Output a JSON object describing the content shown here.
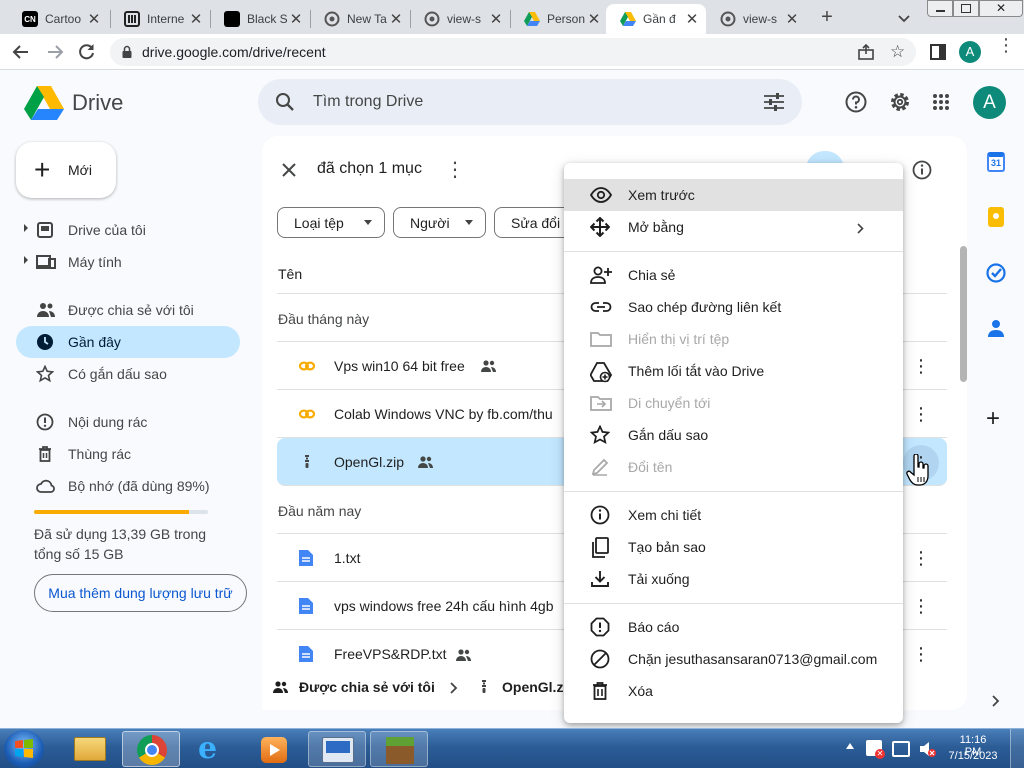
{
  "browser": {
    "tabs": [
      {
        "title": "Cartoo",
        "icon": "cn-icon"
      },
      {
        "title": "Interne",
        "icon": "archive-icon"
      },
      {
        "title": "Black S",
        "icon": "black-square-icon"
      },
      {
        "title": "New Ta",
        "icon": "globe-icon"
      },
      {
        "title": "view-s",
        "icon": "globe-icon"
      },
      {
        "title": "Person",
        "icon": "drive-icon"
      },
      {
        "title": "Gần đ",
        "icon": "drive-icon"
      },
      {
        "title": "view-s",
        "icon": "globe-icon"
      }
    ],
    "active_tab_index": 6,
    "url": "drive.google.com/drive/recent",
    "profile_initial": "A"
  },
  "app": {
    "name": "Drive",
    "search_placeholder": "Tìm trong Drive",
    "avatar_initial": "A",
    "new_button_label": "Mới"
  },
  "sidebar": {
    "items": [
      {
        "label": "Drive của tôi",
        "icon": "my-drive-icon"
      },
      {
        "label": "Máy tính",
        "icon": "computer-icon"
      },
      {
        "label": "Được chia sẻ với tôi",
        "icon": "shared-people-icon"
      },
      {
        "label": "Gần đây",
        "icon": "clock-icon",
        "active": true
      },
      {
        "label": "Có gắn dấu sao",
        "icon": "star-icon"
      },
      {
        "label": "Nội dung rác",
        "icon": "spam-icon"
      },
      {
        "label": "Thùng rác",
        "icon": "trash-icon"
      },
      {
        "label": "Bộ nhớ (đã dùng 89%)",
        "icon": "cloud-icon"
      }
    ],
    "storage_used_fraction": 0.89,
    "storage_text_line1": "Đã sử dụng 13,39 GB trong",
    "storage_text_line2": "tổng số 15 GB",
    "buy_storage_label": "Mua thêm dung lượng lưu trữ"
  },
  "main": {
    "selection_text": "đã chọn 1 mục",
    "filters": [
      "Loại tệp",
      "Người",
      "Sửa đổi"
    ],
    "column_name": "Tên",
    "sections": [
      {
        "title": "Đầu tháng này",
        "files": [
          {
            "name": "Vps win10 64 bit free",
            "icon": "colab-icon",
            "shared": true
          },
          {
            "name": "Colab Windows VNC by fb.com/thu",
            "icon": "colab-icon",
            "shared": false
          },
          {
            "name": "OpenGl.zip",
            "icon": "zip-icon",
            "shared": true,
            "selected": true
          }
        ]
      },
      {
        "title": "Đầu năm nay",
        "files": [
          {
            "name": "1.txt",
            "icon": "doc-icon",
            "shared": false
          },
          {
            "name": "vps windows free 24h cấu hình 4gb",
            "icon": "doc-icon",
            "shared": false
          },
          {
            "name": "FreeVPS&RDP.txt",
            "icon": "doc-icon",
            "shared": true
          }
        ]
      }
    ],
    "footer_path": [
      "Được chia sẻ với tôi",
      "OpenGl.zi"
    ]
  },
  "context_menu": {
    "groups": [
      [
        {
          "label": "Xem trước",
          "icon": "eye-icon",
          "highlighted": true
        },
        {
          "label": "Mở bằng",
          "icon": "open-with-icon",
          "submenu": true
        }
      ],
      [
        {
          "label": "Chia sẻ",
          "icon": "person-add-icon"
        },
        {
          "label": "Sao chép đường liên kết",
          "icon": "link-icon"
        },
        {
          "label": "Hiển thị vị trí tệp",
          "icon": "folder-icon",
          "disabled": true
        },
        {
          "label": "Thêm lối tắt vào Drive",
          "icon": "add-shortcut-icon"
        },
        {
          "label": "Di chuyển tới",
          "icon": "move-icon",
          "disabled": true
        },
        {
          "label": "Gắn dấu sao",
          "icon": "star-icon"
        },
        {
          "label": "Đổi tên",
          "icon": "pencil-icon",
          "disabled": true
        }
      ],
      [
        {
          "label": "Xem chi tiết",
          "icon": "info-icon"
        },
        {
          "label": "Tạo bản sao",
          "icon": "copy-icon"
        },
        {
          "label": "Tải xuống",
          "icon": "download-icon"
        }
      ],
      [
        {
          "label": "Báo cáo",
          "icon": "report-icon"
        },
        {
          "label": "Chặn jesuthasansaran0713@gmail.com",
          "icon": "block-icon"
        },
        {
          "label": "Xóa",
          "icon": "trash-icon"
        }
      ]
    ]
  },
  "side_panel": {
    "calendar_day": "31"
  },
  "taskbar": {
    "time": "11:16 PM",
    "date": "7/15/2023"
  },
  "colors": {
    "accent_blue": "#0b57d0",
    "active_nav": "#c2e7ff",
    "selected_row": "#c2e7ff",
    "chrome_tabstrip": "#dee1e6",
    "drive_bg": "#f8fafd"
  }
}
